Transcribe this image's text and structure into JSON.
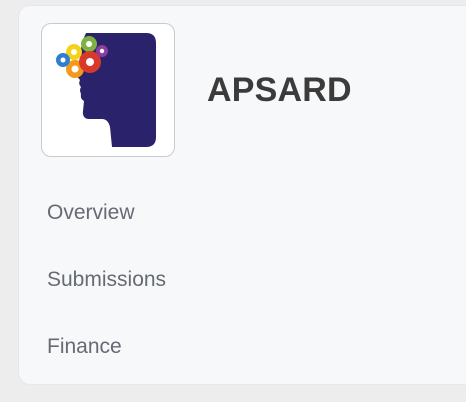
{
  "app": {
    "name": "APSARD",
    "logo_icon": "head-gears-logo-icon"
  },
  "nav": {
    "items": [
      {
        "label": "Overview"
      },
      {
        "label": "Submissions"
      },
      {
        "label": "Finance"
      }
    ]
  },
  "colors": {
    "logo_navy": "#2a236b",
    "gear_red": "#d8392b",
    "gear_orange": "#f39a1e",
    "gear_yellow": "#f4d21b",
    "gear_green": "#7cb342",
    "gear_blue": "#2f7fd1",
    "gear_purple": "#8e3ca0"
  }
}
